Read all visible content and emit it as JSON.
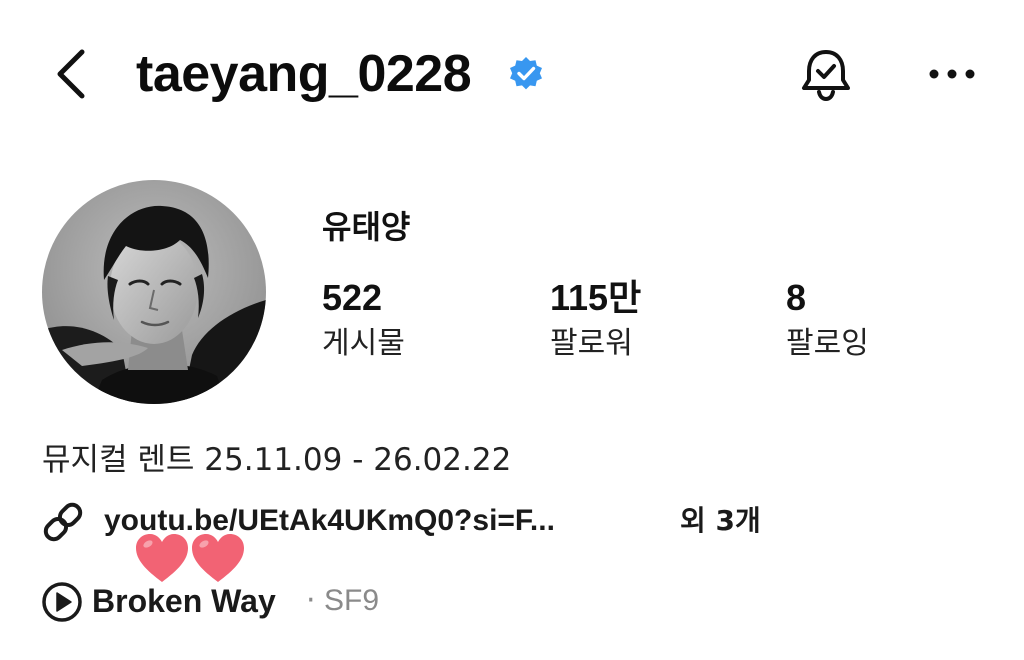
{
  "header": {
    "username": "taeyang_0228",
    "verified_color": "#3897f0",
    "back_icon": "chevron-left-icon",
    "bell_icon": "bell-check-icon",
    "more_icon": "more-horizontal-icon"
  },
  "profile": {
    "display_name": "유태양",
    "avatar_icon": "profile-photo"
  },
  "stats": [
    {
      "value": "522",
      "label": "게시물"
    },
    {
      "value": "115만",
      "label": "팔로워"
    },
    {
      "value": "8",
      "label": "팔로잉"
    }
  ],
  "bio": {
    "line": "뮤지컬 렌트 25.11.09 - 26.02.22",
    "link_text": "youtu.be/UEtAk4UKmQ0?si=F...",
    "link_more": "외 3개",
    "link_icon": "link-icon",
    "heart_color": "#f26374"
  },
  "music": {
    "title": "Broken Way",
    "separator": "·",
    "artist": "SF9",
    "play_icon": "play-circle-icon"
  }
}
